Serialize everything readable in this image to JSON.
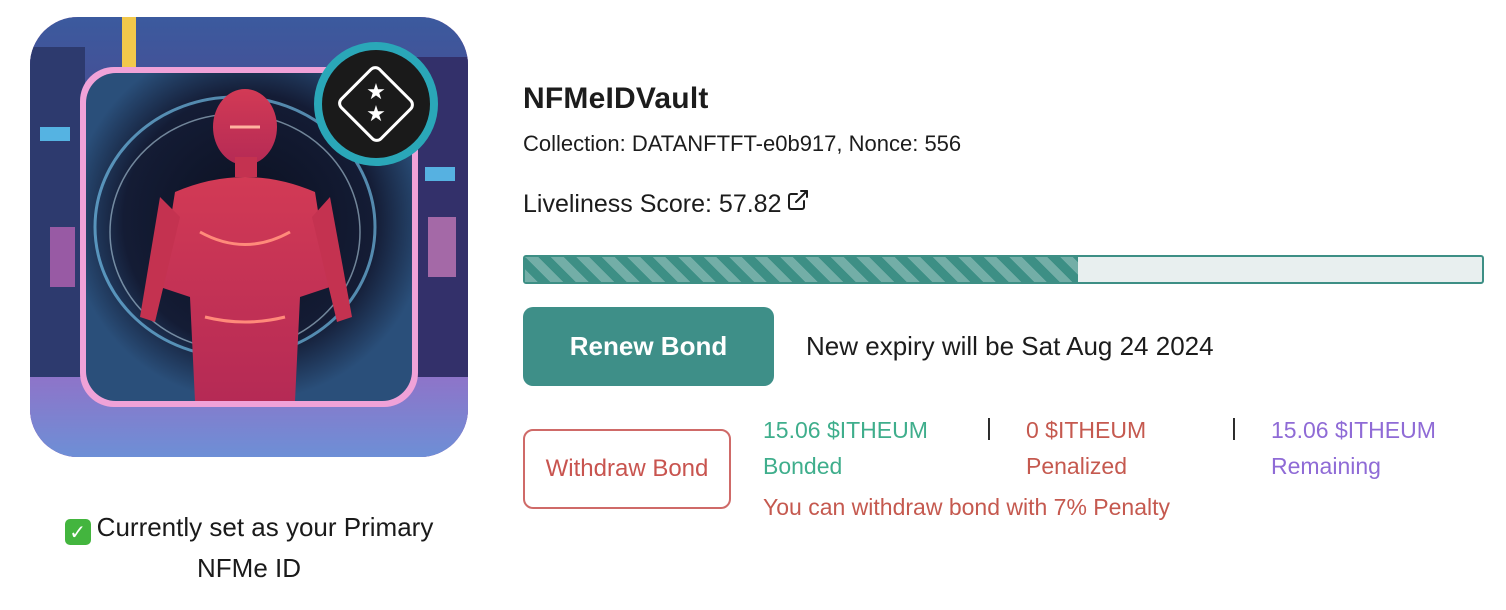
{
  "nft": {
    "image_alt": "NFMe ID avatar - neon red humanoid figure in a cyber city street",
    "badge_icon": "two-stars-rank-badge-icon",
    "primary_status_icon": "check-mark-icon",
    "primary_status_text": "Currently set as your Primary NFMe ID"
  },
  "details": {
    "title": "NFMeIDVault",
    "collection_line": "Collection: DATANFTFT-e0b917, Nonce: 556",
    "liveliness_label": "Liveliness Score: 57.82",
    "liveliness_score": 57.82,
    "external_link_icon": "external-link-icon"
  },
  "bond": {
    "renew_button_label": "Renew Bond",
    "expiry_text": "New expiry will be Sat Aug 24 2024",
    "withdraw_button_label": "Withdraw Bond",
    "separator": "|",
    "bonded_amount": "15.06 $ITHEUM",
    "bonded_label": "Bonded",
    "penalized_amount": "0 $ITHEUM",
    "penalized_label": "Penalized",
    "remaining_amount": "15.06 $ITHEUM",
    "remaining_label": "Remaining",
    "penalty_note": "You can withdraw bond with 7% Penalty"
  },
  "colors": {
    "accent_teal": "#3e8f88",
    "danger_red": "#c8544f",
    "bonded_green": "#3fae8c",
    "remaining_purple": "#8f6bd6"
  }
}
